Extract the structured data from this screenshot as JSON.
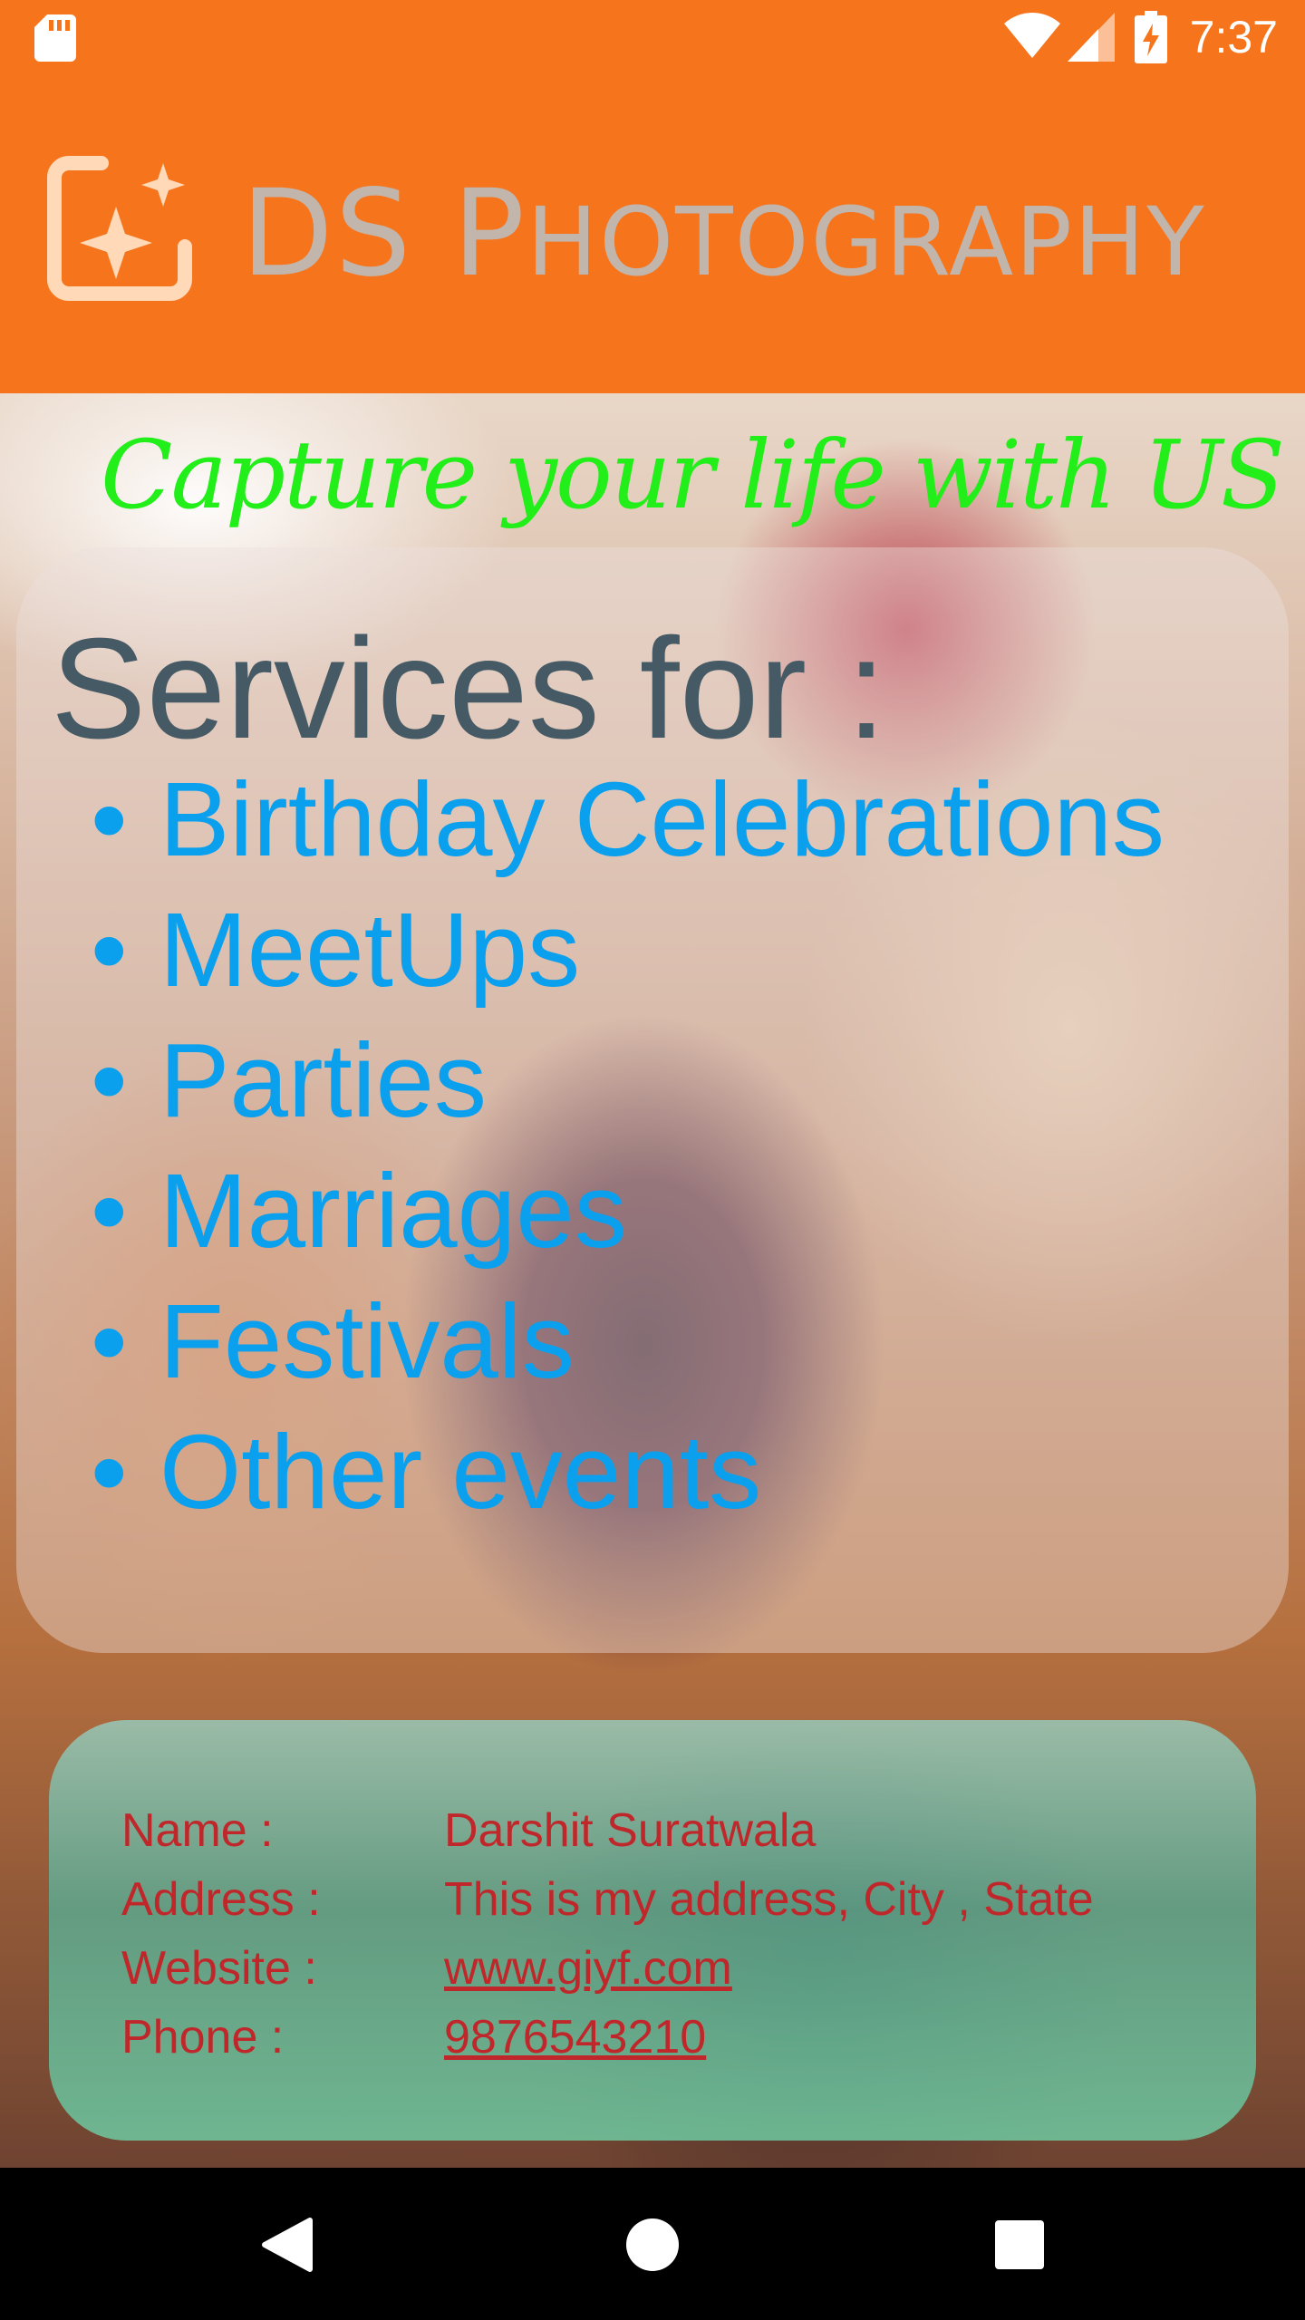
{
  "status_bar": {
    "time": "7:37",
    "icons": [
      "sd-card-icon",
      "wifi-icon",
      "cell-signal-icon",
      "battery-charging-icon"
    ]
  },
  "app_bar": {
    "title_first": "DS ",
    "title_initial": "P",
    "title_rest": "HOTOGRAPHY",
    "icon": "auto-fix-sparkle-icon"
  },
  "main": {
    "tagline": "Capture your life with US",
    "services": {
      "title": "Services for :",
      "bullet": "•",
      "items": [
        "Birthday Celebrations",
        "MeetUps",
        "Parties",
        "Marriages",
        "Festivals",
        "Other events"
      ]
    },
    "contact": {
      "name_label": "Name :",
      "name_value": "Darshit Suratwala",
      "address_label": "Address :",
      "address_value": "This is my address, City , State",
      "website_label": "Website :",
      "website_value": "www.giyf.com",
      "phone_label": "Phone :",
      "phone_value": "9876543210"
    }
  },
  "nav_bar": {
    "buttons": [
      "back-icon",
      "home-icon",
      "recents-icon"
    ]
  },
  "colors": {
    "primary": "#f5741c",
    "tagline": "#22ee1a",
    "service_text": "#0aa0ee",
    "title_text": "#455a64",
    "contact_text": "#c0272a"
  }
}
